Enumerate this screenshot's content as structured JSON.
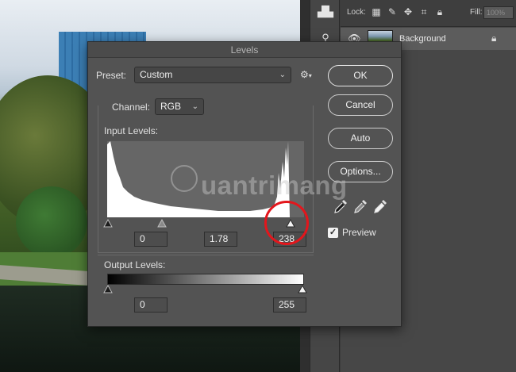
{
  "dialog": {
    "title": "Levels",
    "preset_label": "Preset:",
    "preset_value": "Custom",
    "channel_label": "Channel:",
    "channel_value": "RGB",
    "input_levels_label": "Input Levels:",
    "input_black": "0",
    "input_gamma": "1.78",
    "input_white": "238",
    "output_levels_label": "Output Levels:",
    "output_black": "0",
    "output_white": "255",
    "buttons": {
      "ok": "OK",
      "cancel": "Cancel",
      "auto": "Auto",
      "options": "Options..."
    },
    "preview_label": "Preview",
    "preview_checked": true
  },
  "layers_panel": {
    "lock_label": "Lock:",
    "fill_label": "Fill:",
    "fill_value": "100%",
    "layer_name": "Background"
  },
  "watermark": {
    "text": "uantrimang"
  },
  "icons": {
    "gear": "gear-icon",
    "black_dropper": "black-point-eyedropper-icon",
    "gray_dropper": "gray-point-eyedropper-icon",
    "white_dropper": "white-point-eyedropper-icon",
    "eye": "eye-icon",
    "lock": "lock-icon"
  },
  "colors": {
    "highlight": "#e3161c",
    "dialog_bg": "#535353"
  }
}
